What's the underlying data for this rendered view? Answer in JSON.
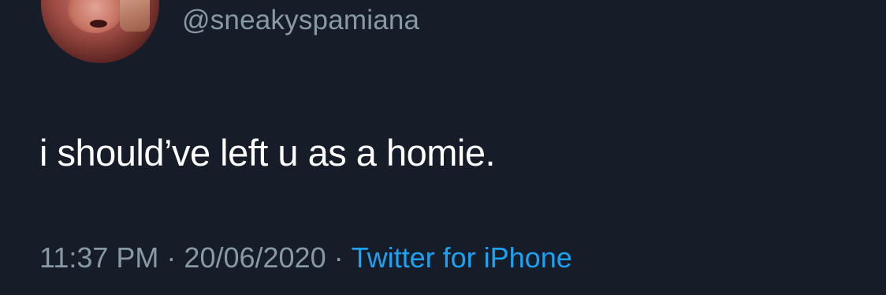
{
  "tweet": {
    "handle": "@sneakyspamiana",
    "text": "i should’ve left u as a homie.",
    "time": "11:37 PM",
    "date": "20/06/2020",
    "separator": "·",
    "source": "Twitter for iPhone"
  },
  "colors": {
    "background": "#15202b",
    "text_primary": "#ffffff",
    "text_secondary": "#8899a6",
    "accent": "#1da1f2"
  }
}
